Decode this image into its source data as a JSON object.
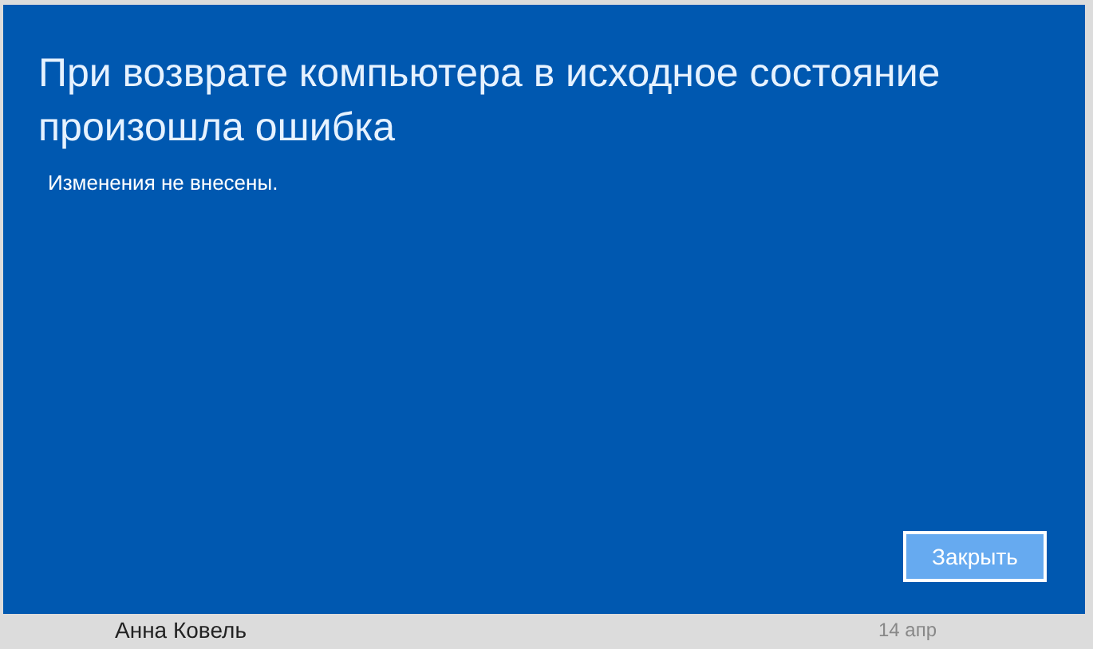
{
  "dialog": {
    "title": "При возврате компьютера в исходное состояние произошла ошибка",
    "message": "Изменения не внесены.",
    "buttons": [
      {
        "label": "Закрыть",
        "kind": "default"
      }
    ]
  },
  "background": {
    "contact_name": "Анна Ковель",
    "date": "14 апр"
  }
}
